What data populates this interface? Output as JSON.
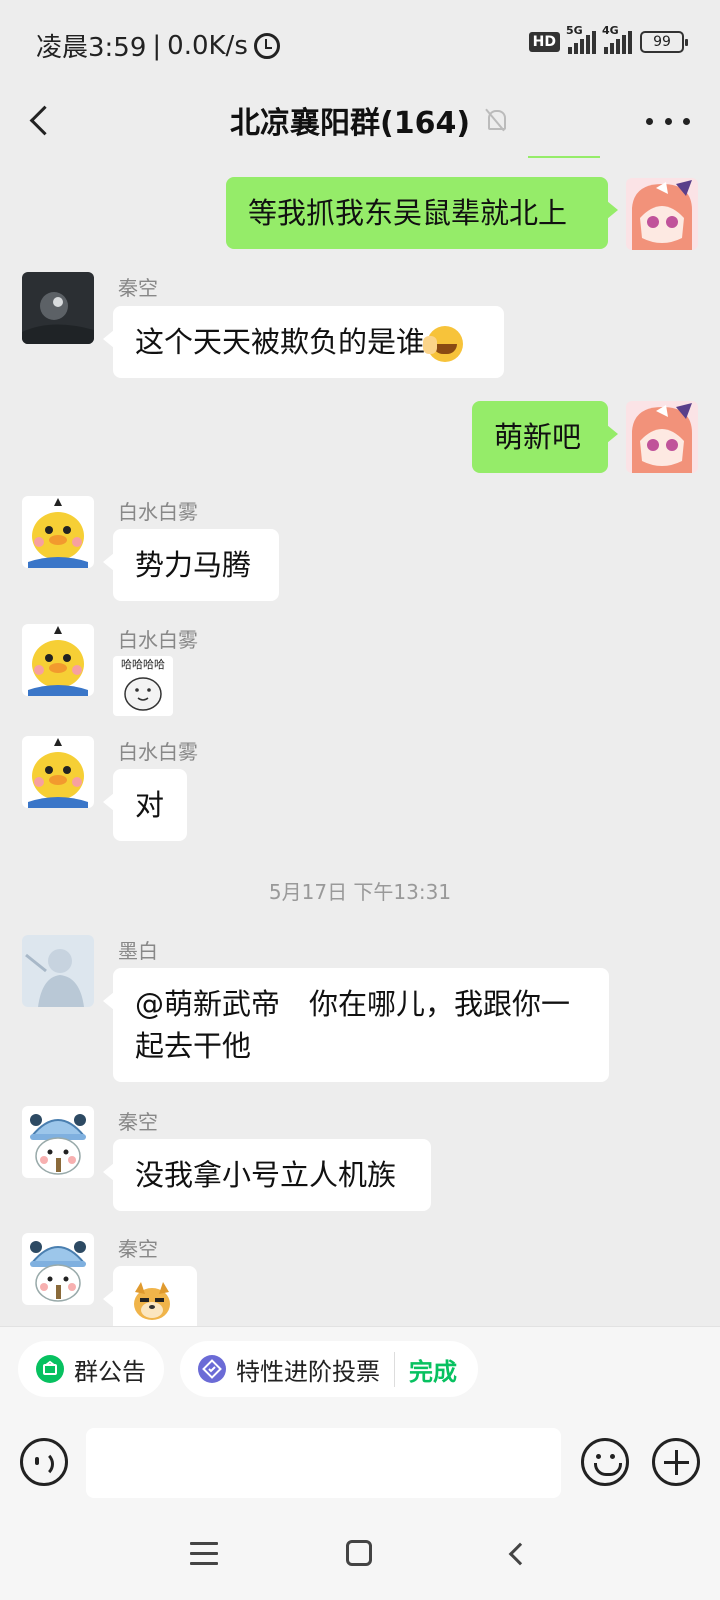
{
  "status_bar": {
    "time": "凌晨3:59",
    "separator": "|",
    "net_speed": "0.0K/s",
    "hd": "HD",
    "net_5g": "5G",
    "net_4g": "4G",
    "battery": "99",
    "icons": [
      "alarm-icon",
      "hd-icon",
      "signal-5g-icon",
      "signal-4g-icon",
      "battery-icon"
    ]
  },
  "nav": {
    "title": "北凉襄阳群(164)",
    "icons": [
      "back-icon",
      "mute-icon",
      "more-icon"
    ]
  },
  "messages": [
    {
      "type": "out",
      "text": "等我抓我东吴鼠辈就北上"
    },
    {
      "type": "in",
      "sender": "秦空",
      "text": "这个天天被欺负的是谁",
      "emoji": "face-palm-emoji"
    },
    {
      "type": "out",
      "text": "萌新吧"
    },
    {
      "type": "in",
      "sender": "白水白雾",
      "text": "势力马腾"
    },
    {
      "type": "in",
      "sender": "白水白雾",
      "sticker": "哈哈哈哈"
    },
    {
      "type": "in",
      "sender": "白水白雾",
      "text": "对"
    },
    {
      "type": "time",
      "text": "5月17日 下午13:31"
    },
    {
      "type": "in",
      "sender": "墨白",
      "line1": "@萌新武帝　你在哪儿，我跟你一",
      "line2": "起去干他"
    },
    {
      "type": "in",
      "sender": "秦空",
      "text": "没我拿小号立人机族"
    },
    {
      "type": "in",
      "sender": "秦空",
      "sticker": "doge-emoji"
    }
  ],
  "quick_bar": {
    "announcement": "群公告",
    "vote": "特性进阶投票",
    "vote_status": "完成"
  },
  "input": {
    "placeholder": ""
  },
  "colors": {
    "background": "#ededed",
    "out_bubble": "#95ec69",
    "in_bubble": "#ffffff",
    "accent": "#07c160"
  }
}
